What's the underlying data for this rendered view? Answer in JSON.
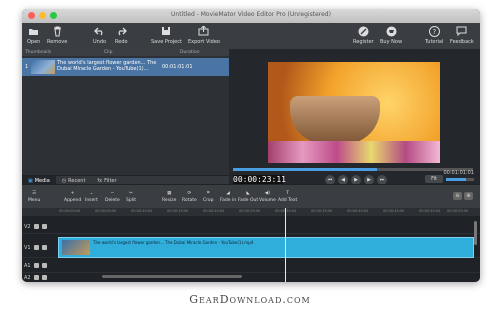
{
  "window": {
    "title": "Untitled - MovieMator Video Editor Pro (Unregistered)"
  },
  "toolbar": {
    "left": [
      {
        "label": "Open",
        "icon": "folder-icon"
      },
      {
        "label": "Remove",
        "icon": "trash-icon"
      },
      {
        "label": "Undo",
        "icon": "undo-icon"
      },
      {
        "label": "Redo",
        "icon": "redo-icon"
      },
      {
        "label": "Save Project",
        "icon": "save-icon"
      },
      {
        "label": "Export Video",
        "icon": "export-icon"
      }
    ],
    "right": [
      {
        "label": "Register",
        "icon": "register-icon"
      },
      {
        "label": "Buy Now",
        "icon": "cart-icon"
      },
      {
        "label": "Tutorial",
        "icon": "help-icon"
      },
      {
        "label": "Feedback",
        "icon": "feedback-icon"
      }
    ]
  },
  "library": {
    "columns": [
      "Thumbnails",
      "Clip",
      "Duration"
    ],
    "rows": [
      {
        "index": "1",
        "clip": "The world's largest flower garden... The Dubai Miracle Garden - YouTube(1)...",
        "duration": "00:01:01:01"
      }
    ],
    "tabs": [
      "Media",
      "Recent",
      "Filter"
    ]
  },
  "player": {
    "timecode": "00:00:23:11",
    "total": "00:01:01:01",
    "zoom": "Fit",
    "progress": 0.6,
    "volume": 0.7
  },
  "edit_toolbar": {
    "menu_label": "Menu",
    "buttons": [
      "Append",
      "Insert",
      "Delete",
      "Split",
      "Resize",
      "Rotate",
      "Crop",
      "Fade in",
      "Fade Out",
      "Volume",
      "Add Text"
    ]
  },
  "timeline": {
    "ruler": [
      "00:00:00:00",
      "00:00:05:00",
      "00:00:10:00",
      "00:00:15:00",
      "00:00:20:00",
      "00:00:25:00",
      "00:00:30:00",
      "00:00:35:00",
      "00:00:40:00",
      "00:00:45:00",
      "00:00:50:00",
      "00:00:55:00"
    ],
    "tracks": [
      "V2",
      "V1",
      "A1",
      "A2"
    ],
    "clip_name": "The world's largest flower garden... The Dubai Miracle Garden - YouTube(1).mp4"
  },
  "watermark": "GearDownload.com"
}
